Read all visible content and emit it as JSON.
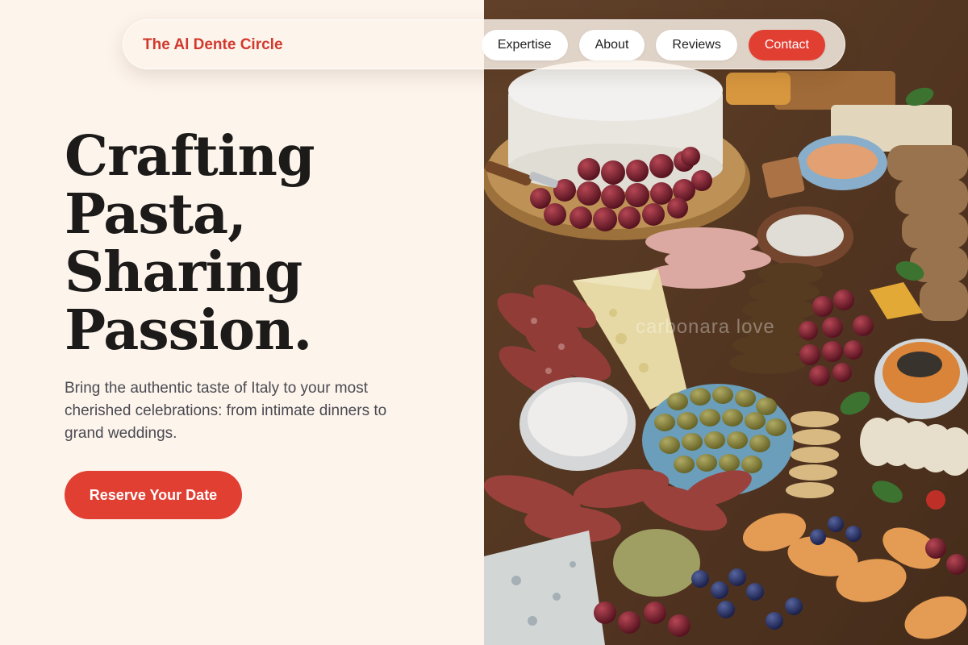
{
  "nav": {
    "brand": "The Al Dente Circle",
    "links": [
      "Expertise",
      "About",
      "Reviews"
    ],
    "contact_label": "Contact"
  },
  "hero": {
    "headline_lines": [
      "Crafting",
      "Pasta,",
      "Sharing",
      "Passion."
    ],
    "subtitle": "Bring the authentic taste of Italy to your most cherished celebrations: from intimate dinners to grand weddings.",
    "cta_label": "Reserve Your Date"
  },
  "image": {
    "watermark": "carbonara love"
  },
  "colors": {
    "accent": "#e23f33",
    "background": "#fdf4ec",
    "text": "#1c1b1a",
    "muted": "#4a4a52"
  }
}
